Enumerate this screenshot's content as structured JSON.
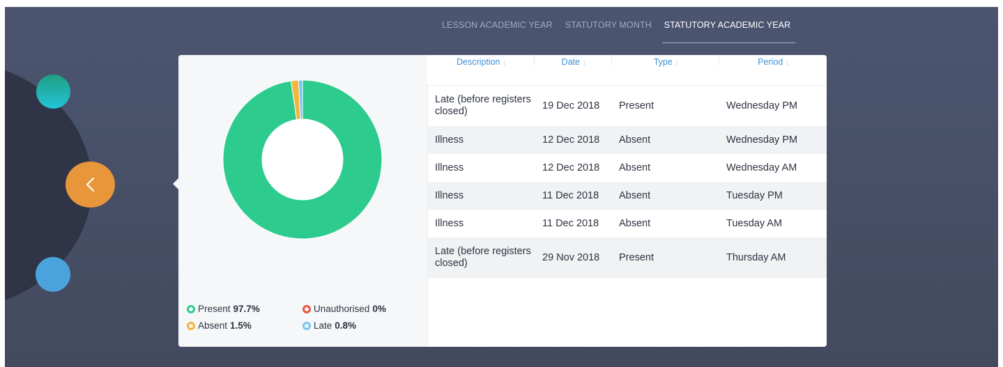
{
  "tabs": [
    {
      "label": "LESSON ACADEMIC YEAR",
      "active": false
    },
    {
      "label": "STATUTORY MONTH",
      "active": false
    },
    {
      "label": "STATUTORY ACADEMIC YEAR",
      "active": true
    }
  ],
  "nav": {
    "back_icon": "chevron-left-icon"
  },
  "colors": {
    "present": "#2ecb8f",
    "absent": "#f5b43b",
    "late": "#74c7f2",
    "unauthorised": "#e8553a",
    "accent_button": "#e8963a",
    "link": "#3d8fd8"
  },
  "chart_data": {
    "type": "pie",
    "style": "donut",
    "slices": [
      {
        "name": "Present",
        "value": 97.7,
        "color": "#2ecb8f"
      },
      {
        "name": "Unauthorised",
        "value": 0,
        "color": "#e8553a"
      },
      {
        "name": "Absent",
        "value": 1.5,
        "color": "#f5b43b"
      },
      {
        "name": "Late",
        "value": 0.8,
        "color": "#74c7f2"
      }
    ]
  },
  "legend": [
    {
      "label": "Present",
      "value": "97.7%",
      "color": "#2ecb8f"
    },
    {
      "label": "Unauthorised",
      "value": "0%",
      "color": "#e8553a"
    },
    {
      "label": "Absent",
      "value": "1.5%",
      "color": "#f5b43b"
    },
    {
      "label": "Late",
      "value": "0.8%",
      "color": "#74c7f2"
    }
  ],
  "table": {
    "headers": [
      "Description",
      "Date",
      "Type",
      "Period"
    ],
    "sort_icon": "↕",
    "rows": [
      {
        "description": "Late (before registers closed)",
        "date": "19 Dec 2018",
        "type": "Present",
        "period": "Wednesday PM"
      },
      {
        "description": "Illness",
        "date": "12 Dec 2018",
        "type": "Absent",
        "period": "Wednesday PM"
      },
      {
        "description": "Illness",
        "date": "12 Dec 2018",
        "type": "Absent",
        "period": "Wednesday AM"
      },
      {
        "description": "Illness",
        "date": "11 Dec 2018",
        "type": "Absent",
        "period": "Tuesday PM"
      },
      {
        "description": "Illness",
        "date": "11 Dec 2018",
        "type": "Absent",
        "period": "Tuesday AM"
      },
      {
        "description": "Late (before registers closed)",
        "date": "29 Nov 2018",
        "type": "Present",
        "period": "Thursday AM"
      }
    ]
  }
}
